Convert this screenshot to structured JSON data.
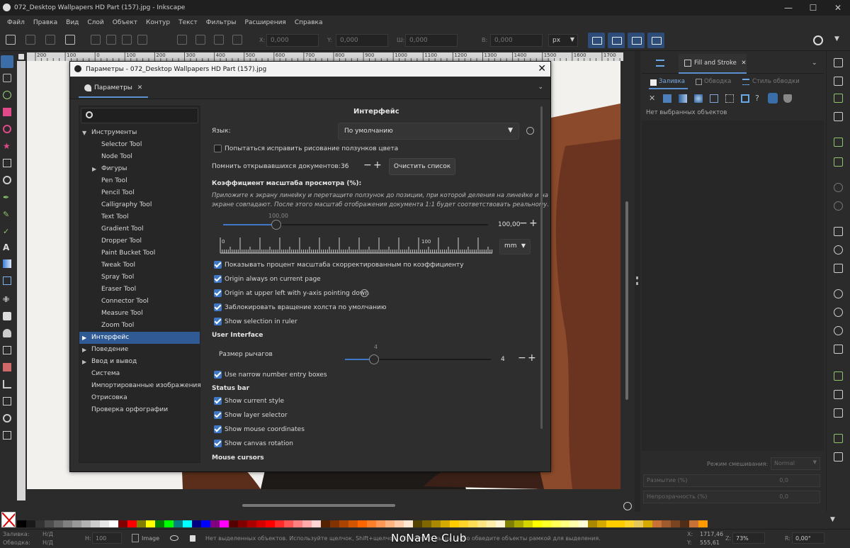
{
  "window": {
    "title": "072_Desktop Wallpapers  HD Part (157).jpg - Inkscape"
  },
  "menu": [
    "Файл",
    "Правка",
    "Вид",
    "Слой",
    "Объект",
    "Контур",
    "Текст",
    "Фильтры",
    "Расширения",
    "Справка"
  ],
  "toolbar": {
    "x_label": "X:",
    "x_value": "0,000",
    "y_label": "Y:",
    "y_value": "0,000",
    "w_label": "Ш:",
    "w_value": "0,000",
    "h_label": "В:",
    "h_value": "0,000",
    "unit": "px"
  },
  "ruler_marks": [
    "200",
    "100",
    "0",
    "100",
    "200",
    "300",
    "400",
    "500",
    "600",
    "700",
    "800",
    "900",
    "1000",
    "1100",
    "1200",
    "1300",
    "1400",
    "1500",
    "1600",
    "1700"
  ],
  "dialog": {
    "title": "Параметры - 072_Desktop Wallpapers  HD Part (157).jpg",
    "tab": "Параметры",
    "tree": {
      "section_tools": "Инструменты",
      "tools": [
        "Selector Tool",
        "Node Tool",
        "Фигуры",
        "Pen Tool",
        "Pencil Tool",
        "Calligraphy Tool",
        "Text Tool",
        "Gradient Tool",
        "Dropper Tool",
        "Paint Bucket Tool",
        "Tweak Tool",
        "Spray Tool",
        "Eraser Tool",
        "Connector Tool",
        "Measure Tool",
        "Zoom Tool"
      ],
      "interface": "Интерфейс",
      "behavior": "Поведение",
      "io": "Ввод и вывод",
      "system": "Система",
      "imported": "Импортированные изображения",
      "rendering": "Отрисовка",
      "spellcheck": "Проверка орфографии"
    },
    "content": {
      "heading": "Интерфейс",
      "language_label": "Язык:",
      "language_value": "По умолчанию",
      "fix_color_label": "Попытаться исправить рисование ползунков цвета",
      "fix_color_checked": false,
      "remember_docs_label": "Помнить открывавшихся документов:",
      "remember_docs_value": "36",
      "clear_list_button": "Очистить список",
      "zoom_heading": "Коэффициент масштаба просмотра (%):",
      "zoom_hint_1": "Приложите к экрану линейку и перетащите ползунок до позиции, при которой деления на линейке и на",
      "zoom_hint_2": "экране совпадают. После этого масштаб отображения документа 1:1 будет соответствовать реальному.",
      "zoom_slider_tip": "100,00",
      "zoom_value": "100,00",
      "zoom_fraction": 0.2,
      "ruler_label_0": "0",
      "ruler_label_100": "100",
      "ruler_unit": "mm",
      "cb_show_zoom": "Показывать процент масштаба скорректированным по коэффициенту",
      "cb_origin_page": "Origin always on current page",
      "cb_origin_upper": "Origin at upper left with y-axis pointing down",
      "cb_lock_rotation": "Заблокировать вращение холста по умолчанию",
      "cb_show_selection": "Show selection in ruler",
      "ui_heading": "User Interface",
      "handle_size_label": "Размер рычагов",
      "handle_slider_tip": "4",
      "handle_size_value": "4",
      "handle_fraction": 0.2,
      "cb_narrow": "Use narrow number entry boxes",
      "statusbar_heading": "Status bar",
      "cb_current_style": "Show current style",
      "cb_layer_selector": "Show layer selector",
      "cb_mouse_coords": "Show mouse coordinates",
      "cb_canvas_rotation": "Show canvas rotation",
      "mouse_cursors_heading": "Mouse cursors"
    }
  },
  "dock": {
    "tab": "Fill and Stroke",
    "subtabs": {
      "fill": "Заливка",
      "stroke": "Обводка",
      "stroke_style": "Стиль обводки"
    },
    "no_selection": "Нет выбранных объектов",
    "blend_label": "Режим смешивания:",
    "blend_value": "Normal",
    "blur_label": "Размытие (%)",
    "blur_value": "0,0",
    "opacity_label": "Непрозрачность (%)",
    "opacity_value": "0,0"
  },
  "palette": {
    "colors": [
      "#000000",
      "#1a1a1a",
      "#333333",
      "#4d4d4d",
      "#666666",
      "#808080",
      "#999999",
      "#b3b3b3",
      "#cccccc",
      "#e6e6e6",
      "#ffffff",
      "#800000",
      "#ff0000",
      "#808000",
      "#ffff00",
      "#008000",
      "#00ff00",
      "#008080",
      "#00ffff",
      "#000080",
      "#0000ff",
      "#800080",
      "#ff00ff",
      "#550000",
      "#800000",
      "#aa0000",
      "#d40000",
      "#ff0000",
      "#ff2a2a",
      "#ff5555",
      "#ff8080",
      "#ffaaaa",
      "#ffd5d5",
      "#552200",
      "#803300",
      "#aa4400",
      "#d45500",
      "#ff6600",
      "#ff7f2a",
      "#ff9955",
      "#ffb380",
      "#ffccaa",
      "#ffe6d5",
      "#554400",
      "#806600",
      "#aa8800",
      "#d4aa00",
      "#ffcc00",
      "#ffd42a",
      "#ffdd55",
      "#ffe680",
      "#ffeeaa",
      "#fff6d5",
      "#808000",
      "#aaaa00",
      "#d4d400",
      "#ffff00",
      "#ffff2a",
      "#ffff55",
      "#ffff80",
      "#ffffaa",
      "#ffffd5",
      "#aa8800",
      "#d4aa00",
      "#ffcc00",
      "#ffcc00",
      "#ffd42a",
      "#e6c85a",
      "#d4aa00",
      "#c87137",
      "#a05a2c",
      "#784421",
      "#502d16",
      "#c87137",
      "#ff9900"
    ]
  },
  "status": {
    "fill_label": "Заливка:",
    "fill_value": "Н/Д",
    "stroke_label": "Обводка:",
    "stroke_value": "Н/Д",
    "h_label": "Н:",
    "h_value": "100",
    "layer": "Image",
    "message": "Нет выделенных объектов. Используйте щелчок, Shift+щелчок, Alt+колесо мыши, либо обведите объекты рамкой для выделения.",
    "x_label": "X:",
    "x_value": "1717,46",
    "y_label": "Y:",
    "y_value": "555,61",
    "z_label": "Z:",
    "zoom": "73%",
    "r_label": "R:",
    "rotation": "0,00°"
  },
  "watermark": "NoNaMe Club"
}
